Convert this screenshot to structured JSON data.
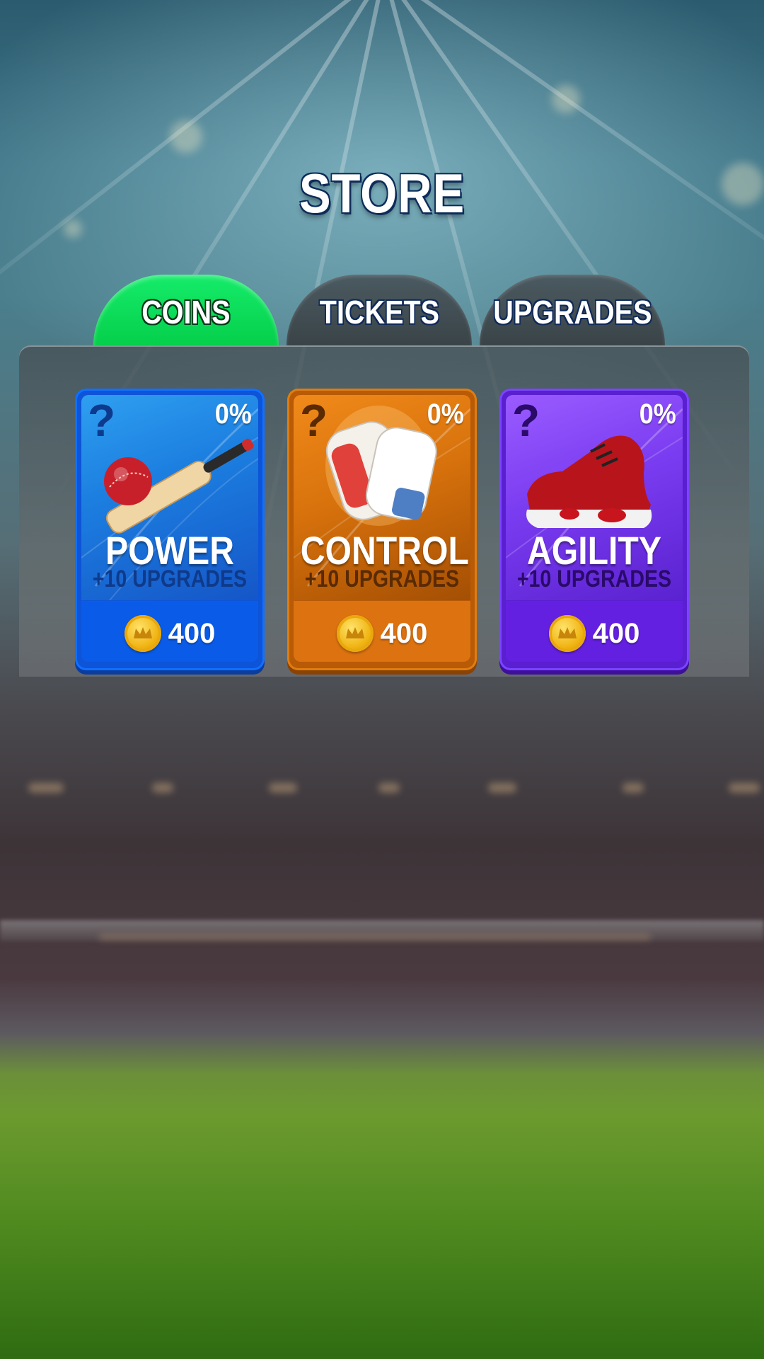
{
  "screen": {
    "title": "STORE"
  },
  "tabs": [
    {
      "label": "COINS",
      "active": true
    },
    {
      "label": "TICKETS",
      "active": false
    },
    {
      "label": "UPGRADES",
      "active": false
    }
  ],
  "cards": [
    {
      "name": "POWER",
      "subtitle": "+10 UPGRADES",
      "percent": "0%",
      "price": "400",
      "icon": "cricket-bat-ball-icon",
      "color": "#0d5fe6"
    },
    {
      "name": "CONTROL",
      "subtitle": "+10 UPGRADES",
      "percent": "0%",
      "price": "400",
      "icon": "batting-gloves-icon",
      "color": "#d86a08"
    },
    {
      "name": "AGILITY",
      "subtitle": "+10 UPGRADES",
      "percent": "0%",
      "price": "400",
      "icon": "sneaker-icon",
      "color": "#6a2be8"
    }
  ],
  "currency_icon": "coin-icon",
  "colors": {
    "active_tab": "#0ddc5c",
    "inactive_tab": "#444f54",
    "title_outline": "#0d2c5a"
  }
}
